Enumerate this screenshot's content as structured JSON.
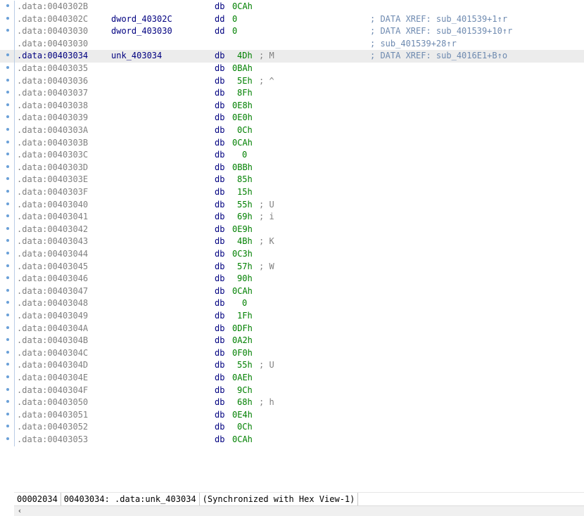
{
  "listing": {
    "rows": [
      {
        "seg": ".data",
        "off": "0040302B",
        "name": "",
        "mnem": "db",
        "oper": "0CAh",
        "pad": 0,
        "cmt": "",
        "xref": "",
        "dot": true,
        "sel": false
      },
      {
        "seg": ".data",
        "off": "0040302C",
        "name": "dword_40302C",
        "mnem": "dd",
        "oper": "0",
        "pad": 0,
        "cmt": "",
        "xref": "; DATA XREF: sub_401539+1↑r",
        "dot": true,
        "sel": false
      },
      {
        "seg": ".data",
        "off": "00403030",
        "name": "dword_403030",
        "mnem": "dd",
        "oper": "0",
        "pad": 0,
        "cmt": "",
        "xref": "; DATA XREF: sub_401539+10↑r",
        "dot": true,
        "sel": false
      },
      {
        "seg": ".data",
        "off": "00403030",
        "name": "",
        "mnem": "",
        "oper": "",
        "pad": 0,
        "cmt": "",
        "xref": "; sub_401539+28↑r",
        "dot": false,
        "sel": false
      },
      {
        "seg": ".data",
        "off": "00403034",
        "name": "unk_403034",
        "mnem": "db",
        "oper": "4Dh",
        "pad": 1,
        "cmt": "; M",
        "xref": "; DATA XREF: sub_4016E1+B↑o",
        "dot": true,
        "sel": true
      },
      {
        "seg": ".data",
        "off": "00403035",
        "name": "",
        "mnem": "db",
        "oper": "0BAh",
        "pad": 0,
        "cmt": "",
        "xref": "",
        "dot": true,
        "sel": false
      },
      {
        "seg": ".data",
        "off": "00403036",
        "name": "",
        "mnem": "db",
        "oper": "5Eh",
        "pad": 1,
        "cmt": "; ^",
        "xref": "",
        "dot": true,
        "sel": false
      },
      {
        "seg": ".data",
        "off": "00403037",
        "name": "",
        "mnem": "db",
        "oper": "8Fh",
        "pad": 1,
        "cmt": "",
        "xref": "",
        "dot": true,
        "sel": false
      },
      {
        "seg": ".data",
        "off": "00403038",
        "name": "",
        "mnem": "db",
        "oper": "0E8h",
        "pad": 0,
        "cmt": "",
        "xref": "",
        "dot": true,
        "sel": false
      },
      {
        "seg": ".data",
        "off": "00403039",
        "name": "",
        "mnem": "db",
        "oper": "0E0h",
        "pad": 0,
        "cmt": "",
        "xref": "",
        "dot": true,
        "sel": false
      },
      {
        "seg": ".data",
        "off": "0040303A",
        "name": "",
        "mnem": "db",
        "oper": "0Ch",
        "pad": 1,
        "cmt": "",
        "xref": "",
        "dot": true,
        "sel": false
      },
      {
        "seg": ".data",
        "off": "0040303B",
        "name": "",
        "mnem": "db",
        "oper": "0CAh",
        "pad": 0,
        "cmt": "",
        "xref": "",
        "dot": true,
        "sel": false
      },
      {
        "seg": ".data",
        "off": "0040303C",
        "name": "",
        "mnem": "db",
        "oper": "0",
        "pad": 2,
        "cmt": "",
        "xref": "",
        "dot": true,
        "sel": false
      },
      {
        "seg": ".data",
        "off": "0040303D",
        "name": "",
        "mnem": "db",
        "oper": "0BBh",
        "pad": 0,
        "cmt": "",
        "xref": "",
        "dot": true,
        "sel": false
      },
      {
        "seg": ".data",
        "off": "0040303E",
        "name": "",
        "mnem": "db",
        "oper": "85h",
        "pad": 1,
        "cmt": "",
        "xref": "",
        "dot": true,
        "sel": false
      },
      {
        "seg": ".data",
        "off": "0040303F",
        "name": "",
        "mnem": "db",
        "oper": "15h",
        "pad": 1,
        "cmt": "",
        "xref": "",
        "dot": true,
        "sel": false
      },
      {
        "seg": ".data",
        "off": "00403040",
        "name": "",
        "mnem": "db",
        "oper": "55h",
        "pad": 1,
        "cmt": "; U",
        "xref": "",
        "dot": true,
        "sel": false
      },
      {
        "seg": ".data",
        "off": "00403041",
        "name": "",
        "mnem": "db",
        "oper": "69h",
        "pad": 1,
        "cmt": "; i",
        "xref": "",
        "dot": true,
        "sel": false
      },
      {
        "seg": ".data",
        "off": "00403042",
        "name": "",
        "mnem": "db",
        "oper": "0E9h",
        "pad": 0,
        "cmt": "",
        "xref": "",
        "dot": true,
        "sel": false
      },
      {
        "seg": ".data",
        "off": "00403043",
        "name": "",
        "mnem": "db",
        "oper": "4Bh",
        "pad": 1,
        "cmt": "; K",
        "xref": "",
        "dot": true,
        "sel": false
      },
      {
        "seg": ".data",
        "off": "00403044",
        "name": "",
        "mnem": "db",
        "oper": "0C3h",
        "pad": 0,
        "cmt": "",
        "xref": "",
        "dot": true,
        "sel": false
      },
      {
        "seg": ".data",
        "off": "00403045",
        "name": "",
        "mnem": "db",
        "oper": "57h",
        "pad": 1,
        "cmt": "; W",
        "xref": "",
        "dot": true,
        "sel": false
      },
      {
        "seg": ".data",
        "off": "00403046",
        "name": "",
        "mnem": "db",
        "oper": "90h",
        "pad": 1,
        "cmt": "",
        "xref": "",
        "dot": true,
        "sel": false
      },
      {
        "seg": ".data",
        "off": "00403047",
        "name": "",
        "mnem": "db",
        "oper": "0CAh",
        "pad": 0,
        "cmt": "",
        "xref": "",
        "dot": true,
        "sel": false
      },
      {
        "seg": ".data",
        "off": "00403048",
        "name": "",
        "mnem": "db",
        "oper": "0",
        "pad": 2,
        "cmt": "",
        "xref": "",
        "dot": true,
        "sel": false
      },
      {
        "seg": ".data",
        "off": "00403049",
        "name": "",
        "mnem": "db",
        "oper": "1Fh",
        "pad": 1,
        "cmt": "",
        "xref": "",
        "dot": true,
        "sel": false
      },
      {
        "seg": ".data",
        "off": "0040304A",
        "name": "",
        "mnem": "db",
        "oper": "0DFh",
        "pad": 0,
        "cmt": "",
        "xref": "",
        "dot": true,
        "sel": false
      },
      {
        "seg": ".data",
        "off": "0040304B",
        "name": "",
        "mnem": "db",
        "oper": "0A2h",
        "pad": 0,
        "cmt": "",
        "xref": "",
        "dot": true,
        "sel": false
      },
      {
        "seg": ".data",
        "off": "0040304C",
        "name": "",
        "mnem": "db",
        "oper": "0F0h",
        "pad": 0,
        "cmt": "",
        "xref": "",
        "dot": true,
        "sel": false
      },
      {
        "seg": ".data",
        "off": "0040304D",
        "name": "",
        "mnem": "db",
        "oper": "55h",
        "pad": 1,
        "cmt": "; U",
        "xref": "",
        "dot": true,
        "sel": false
      },
      {
        "seg": ".data",
        "off": "0040304E",
        "name": "",
        "mnem": "db",
        "oper": "0AEh",
        "pad": 0,
        "cmt": "",
        "xref": "",
        "dot": true,
        "sel": false
      },
      {
        "seg": ".data",
        "off": "0040304F",
        "name": "",
        "mnem": "db",
        "oper": "9Ch",
        "pad": 1,
        "cmt": "",
        "xref": "",
        "dot": true,
        "sel": false
      },
      {
        "seg": ".data",
        "off": "00403050",
        "name": "",
        "mnem": "db",
        "oper": "68h",
        "pad": 1,
        "cmt": "; h",
        "xref": "",
        "dot": true,
        "sel": false
      },
      {
        "seg": ".data",
        "off": "00403051",
        "name": "",
        "mnem": "db",
        "oper": "0E4h",
        "pad": 0,
        "cmt": "",
        "xref": "",
        "dot": true,
        "sel": false
      },
      {
        "seg": ".data",
        "off": "00403052",
        "name": "",
        "mnem": "db",
        "oper": "0Ch",
        "pad": 1,
        "cmt": "",
        "xref": "",
        "dot": true,
        "sel": false
      },
      {
        "seg": ".data",
        "off": "00403053",
        "name": "",
        "mnem": "db",
        "oper": "0CAh",
        "pad": 0,
        "cmt": "",
        "xref": "",
        "dot": true,
        "sel": false
      }
    ]
  },
  "status": {
    "file_offset": "00002034",
    "location": "00403034: .data:unk_403034",
    "sync": "(Synchronized with Hex View-1)"
  },
  "scrollbar": {
    "left_arrow": "‹"
  }
}
